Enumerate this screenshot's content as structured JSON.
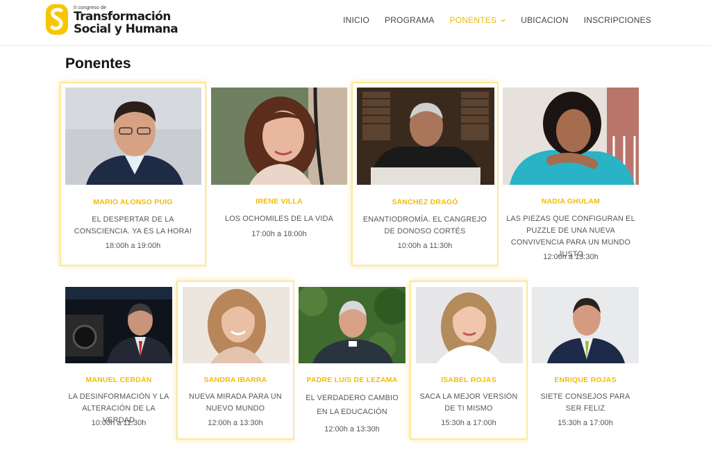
{
  "header": {
    "logo": {
      "small": "II congreso de",
      "line1": "Transformación",
      "line2": "Social y Humana"
    },
    "nav": [
      {
        "label": "INICIO",
        "active": false
      },
      {
        "label": "PROGRAMA",
        "active": false
      },
      {
        "label": "PONENTES",
        "active": true
      },
      {
        "label": "UBICACION",
        "active": false
      },
      {
        "label": "INSCRIPCIONES",
        "active": false
      }
    ]
  },
  "page": {
    "title": "Ponentes"
  },
  "colors": {
    "accent": "#f2bd00",
    "highlight_border": "#fde79a",
    "text": "#555555"
  },
  "speakers_row1": [
    {
      "name": "MARIO ALONSO PUIG",
      "talk": "EL DESPERTAR DE LA CONSCIENCIA. YA ES LA HORA!",
      "time": "18:00h a 19:00h",
      "highlighted": true
    },
    {
      "name": "IRENE VILLA",
      "talk": "LOS OCHOMILES DE LA VIDA",
      "time": "17:00h a 18:00h",
      "highlighted": false
    },
    {
      "name": "SÁNCHEZ DRAGÓ",
      "talk": "ENANTIODROMÍA. EL CANGREJO DE DONOSO CORTÉS",
      "time": "10:00h a 11:30h",
      "highlighted": true
    },
    {
      "name": "NADIA GHULAM",
      "talk": "LAS PIEZAS QUE CONFIGURAN EL PUZZLE DE UNA NUEVA CONVIVENCIA PARA UN MUNDO JUSTO",
      "time": "12:00h a 13:30h",
      "highlighted": false
    }
  ],
  "speakers_row2": [
    {
      "name": "MANUEL CERDÁN",
      "talk": "LA DESINFORMACIÓN Y LA ALTERACIÓN DE LA VERDAD",
      "time": "10:00h a 11:30h",
      "highlighted": false
    },
    {
      "name": "SANDRA IBARRA",
      "talk": "NUEVA MIRADA PARA UN NUEVO MUNDO",
      "time": "12:00h a 13:30h",
      "highlighted": true
    },
    {
      "name": "PADRE LUIS DE LEZAMA",
      "talk": "EL VERDADERO CAMBIO EN LA EDUCACIÓN",
      "time": "12:00h a 13:30h",
      "highlighted": false
    },
    {
      "name": "ISABEL ROJAS",
      "talk": "SACA LA MEJOR VERSIÓN DE TI MISMO",
      "time": "15:30h a 17:00h",
      "highlighted": true
    },
    {
      "name": "ENRIQUE ROJAS",
      "talk": "SIETE CONSEJOS PARA SER FELIZ",
      "time": "15:30h a 17:00h",
      "highlighted": false
    }
  ]
}
